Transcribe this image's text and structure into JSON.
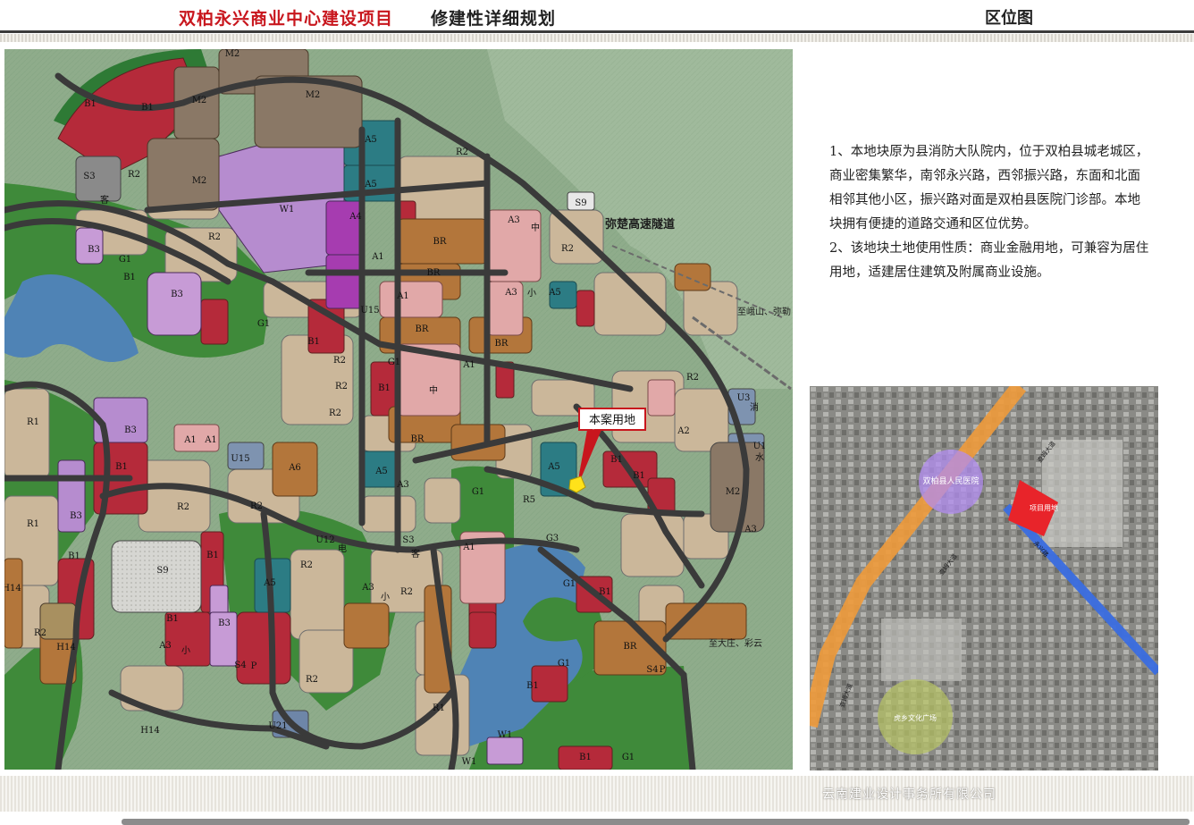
{
  "header": {
    "title_red": "双柏永兴商业中心建设项目",
    "title_black": "修建性详细规划",
    "section": "区位图"
  },
  "map": {
    "callout": "本案用地",
    "tunnel": "弥楚高速隧道",
    "to_east": "至峨山、弥勒",
    "to_south": "至大庄、彩云",
    "zones": [
      "B1",
      "B1",
      "M2",
      "M2",
      "M2",
      "S3",
      "客",
      "R2",
      "M2",
      "W1",
      "A5",
      "A5",
      "A4",
      "B3",
      "G1",
      "B1",
      "A1",
      "B3",
      "G1",
      "R2",
      "R2",
      "B1",
      "R2",
      "S9",
      "中",
      "A3",
      "R2",
      "BR",
      "BR",
      "A1",
      "A5",
      "A3",
      "小",
      "G1",
      "U15",
      "R2",
      "BR",
      "BR",
      "B1",
      "中",
      "A1",
      "R1",
      "B3",
      "A1",
      "A1",
      "B1",
      "BR",
      "A6",
      "U15",
      "R2",
      "A5",
      "A3",
      "G1",
      "R5",
      "R2",
      "B1",
      "A5",
      "B1",
      "A2",
      "R2",
      "U3",
      "消",
      "U1",
      "水",
      "M2",
      "A3",
      "R2",
      "B3",
      "R1",
      "S9",
      "B1",
      "R2",
      "A5",
      "U12",
      "电",
      "S3",
      "客",
      "A1",
      "R2",
      "G3",
      "G1",
      "B1",
      "A3",
      "小",
      "R2",
      "B1",
      "H14",
      "BR",
      "B1",
      "B3",
      "A3",
      "小",
      "S4",
      "P",
      "R2",
      "H14",
      "U21",
      "R1",
      "W1",
      "B1",
      "G1",
      "H14",
      "S4",
      "W1",
      "B1",
      "G1",
      "R2",
      "P"
    ]
  },
  "description": {
    "paragraphs": [
      "1、本地块原为县消防大队院内，位于双柏县城老城区，商业密集繁华，南邻永兴路，西邻振兴路，东面和北面相邻其他小区，振兴路对面是双柏县医院门诊部。本地块拥有便捷的道路交通和区位优势。",
      "2、该地块土地使用性质：商业金融用地，可兼容为居住用地，适建居住建筑及附属商业设施。"
    ]
  },
  "aerial": {
    "hospital": "双柏县人民医院",
    "project": "项目用地",
    "square": "虎乡文化广场",
    "road_main_a": "查姆大道",
    "road_main_b": "查姆大道",
    "road_main_c": "查姆大道",
    "road_yongxing": "永兴路"
  },
  "footer": {
    "company": "云南建业设计事务所有限公司"
  },
  "colors": {
    "title_red": "#c8161d",
    "green_land": "#3f8a3a",
    "residential": "#cbb79a",
    "commercial": "#b52a3a",
    "industrial": "#8a7866",
    "water": "#4f83b5",
    "road": "#3a3a3a",
    "orange_road": "#f0a046",
    "blue_road": "#3a6de0"
  }
}
